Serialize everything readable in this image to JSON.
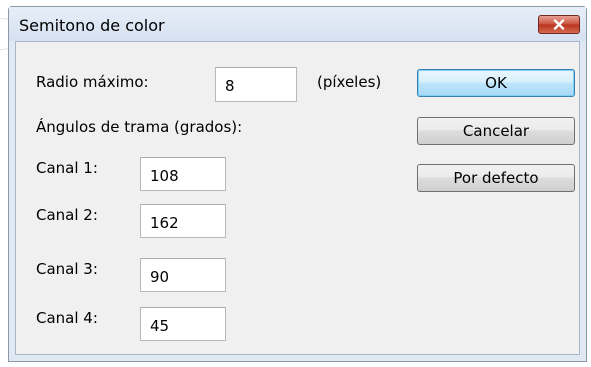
{
  "window": {
    "title": "Semitono de color"
  },
  "radius": {
    "label": "Radio máximo:",
    "value": "8",
    "unit": "(píxeles)"
  },
  "angles": {
    "heading": "Ángulos de trama (grados):",
    "channels": [
      {
        "label": "Canal 1:",
        "value": "108"
      },
      {
        "label": "Canal 2:",
        "value": "162"
      },
      {
        "label": "Canal 3:",
        "value": "90"
      },
      {
        "label": "Canal 4:",
        "value": "45"
      }
    ]
  },
  "buttons": {
    "ok": "OK",
    "cancel": "Cancelar",
    "defaults": "Por defecto"
  },
  "colors": {
    "close_red": "#c9513e",
    "default_border": "#3c7fb1",
    "dialog_bg": "#f0f0f0"
  }
}
